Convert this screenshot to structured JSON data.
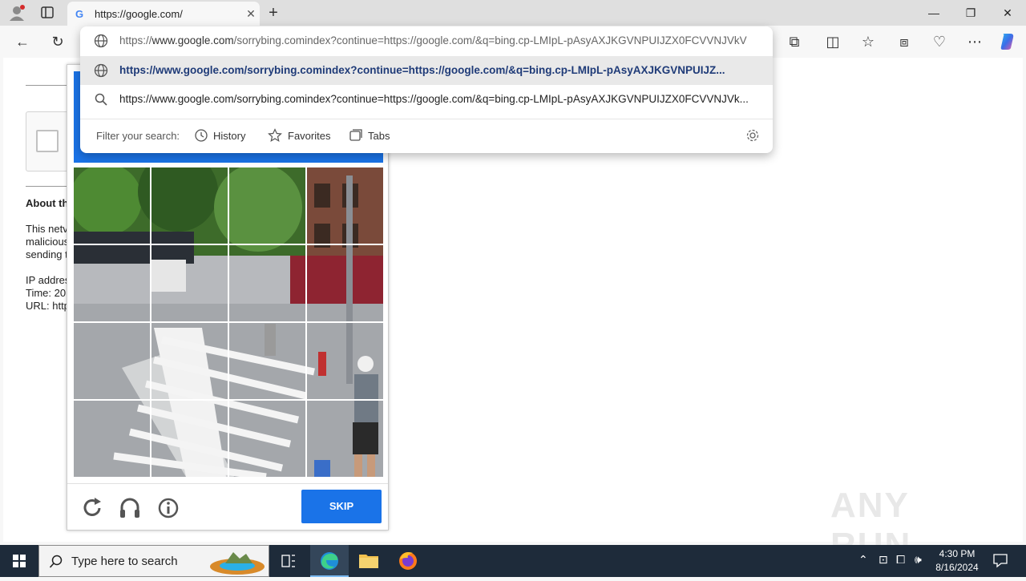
{
  "browser": {
    "tab_title": "https://google.com/",
    "tab_favicon": "G",
    "address": {
      "prefix": "https://",
      "domain": "www.google.com",
      "rest": "/sorrybing.comindex?continue=https://google.com/&q=bing.cp-LMIpL-pAsyAXJKGVNPUIJZX0FCVVNJVkV"
    },
    "suggestions": [
      {
        "text": "https://www.google.com/sorrybing.comindex?continue=https://google.com/&q=bing.cp-LMIpL-pAsyAXJKGVNPUIJZ...",
        "icon": "globe-icon"
      },
      {
        "text": "https://www.google.com/sorrybing.comindex?continue=https://google.com/&q=bing.cp-LMIpL-pAsyAXJKGVNPUIJZX0FCVVNJVk...",
        "icon": "search-icon"
      }
    ],
    "filter": {
      "label": "Filter your search:",
      "history": "History",
      "favorites": "Favorites",
      "tabs": "Tabs"
    }
  },
  "sorry_page": {
    "about": "About th",
    "lines": [
      "This netv",
      "malicious",
      "sending t",
      "IP addres",
      "Time: 20:",
      "URL: http"
    ]
  },
  "captcha": {
    "skip_label": "SKIP",
    "accent": "#1a73e8"
  },
  "taskbar": {
    "search_placeholder": "Type here to search",
    "time": "4:30 PM",
    "date": "8/16/2024"
  },
  "watermark": "ANY RUN"
}
